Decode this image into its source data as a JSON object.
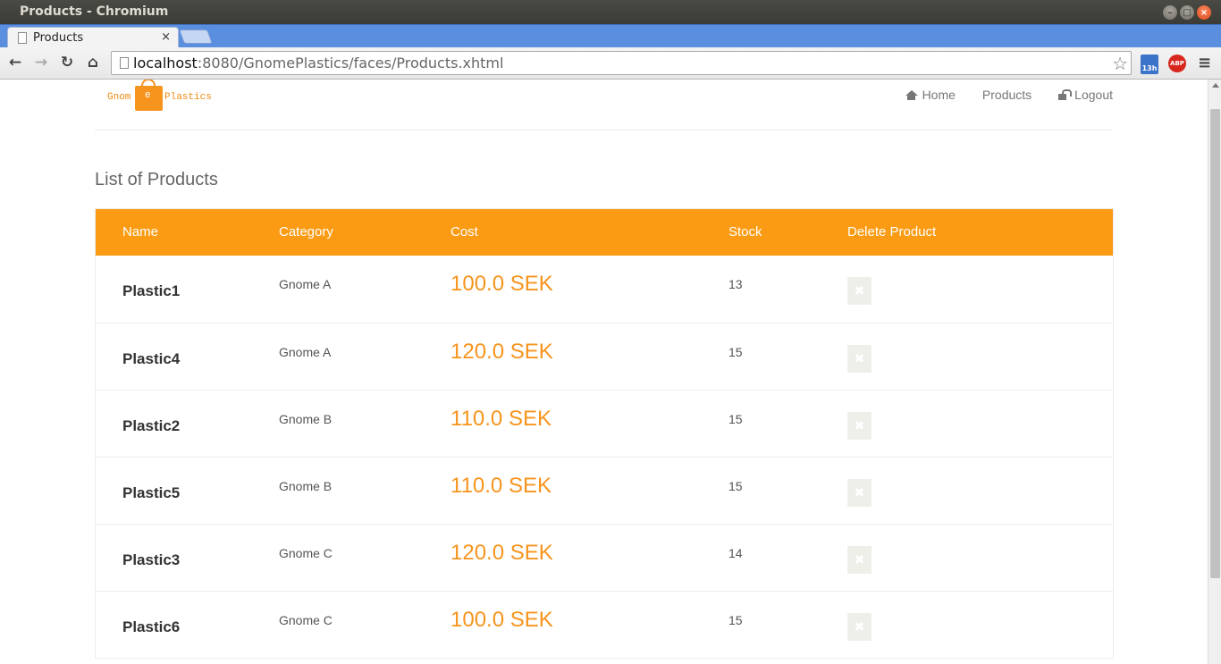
{
  "window": {
    "title": "Products - Chromium",
    "tab_title": "Products",
    "tab_close": "×",
    "controls": {
      "minimize": "–",
      "maximize": "□",
      "close": "×"
    }
  },
  "toolbar": {
    "url_host": "localhost",
    "url_rest": ":8080/GnomePlastics/faces/Products.xhtml",
    "calendar_badge": "13h",
    "adblock_label": "ABP"
  },
  "site": {
    "logo_left": "Gnom",
    "logo_letter": "e",
    "logo_right": "Plastics",
    "nav": {
      "home": "Home",
      "products": "Products",
      "logout": "Logout"
    }
  },
  "main": {
    "title": "List of Products",
    "columns": {
      "name": "Name",
      "category": "Category",
      "cost": "Cost",
      "stock": "Stock",
      "delete": "Delete Product"
    },
    "rows": [
      {
        "name": "Plastic1",
        "category": "Gnome A",
        "cost": "100.0 SEK",
        "stock": "13"
      },
      {
        "name": "Plastic4",
        "category": "Gnome A",
        "cost": "120.0 SEK",
        "stock": "15"
      },
      {
        "name": "Plastic2",
        "category": "Gnome B",
        "cost": "110.0 SEK",
        "stock": "15"
      },
      {
        "name": "Plastic5",
        "category": "Gnome B",
        "cost": "110.0 SEK",
        "stock": "15"
      },
      {
        "name": "Plastic3",
        "category": "Gnome C",
        "cost": "120.0 SEK",
        "stock": "14"
      },
      {
        "name": "Plastic6",
        "category": "Gnome C",
        "cost": "100.0 SEK",
        "stock": "15"
      }
    ],
    "delete_glyph": "✖"
  },
  "colors": {
    "accent": "#fa9b13",
    "price": "#f7941d",
    "tabstrip": "#5a8fe0"
  }
}
